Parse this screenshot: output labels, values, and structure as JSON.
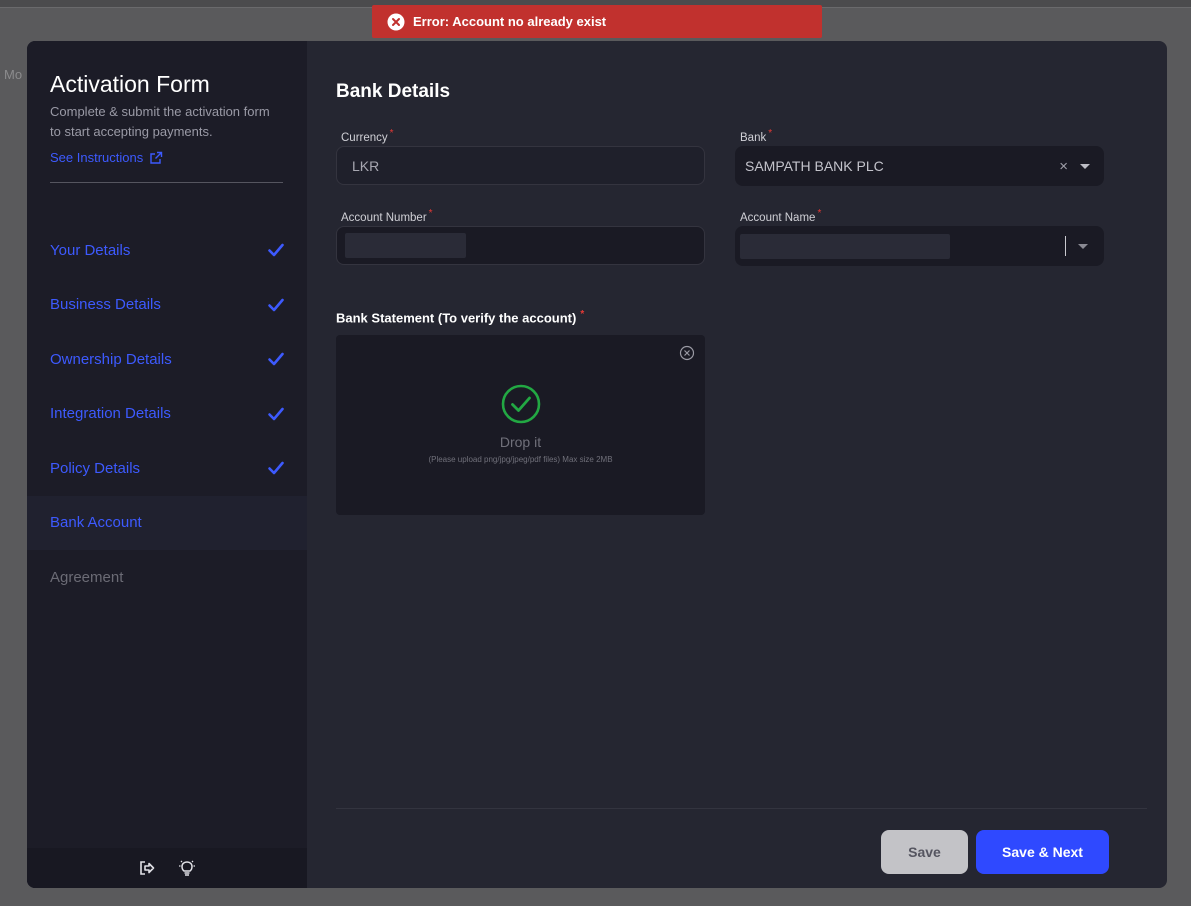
{
  "background": {
    "partial_text": "Mo"
  },
  "toast": {
    "message": "Error: Account no already exist",
    "color": "#c1312e",
    "icon": "error-circle-icon"
  },
  "sidebar": {
    "title": "Activation Form",
    "subtitle": "Complete & submit the activation form to start accepting payments.",
    "instructions_link": "See Instructions",
    "steps": [
      {
        "label": "Your Details",
        "status": "completed"
      },
      {
        "label": "Business Details",
        "status": "completed"
      },
      {
        "label": "Ownership Details",
        "status": "completed"
      },
      {
        "label": "Integration Details",
        "status": "completed"
      },
      {
        "label": "Policy Details",
        "status": "completed"
      },
      {
        "label": "Bank Account",
        "status": "active"
      },
      {
        "label": "Agreement",
        "status": "disabled"
      }
    ],
    "footer_icons": [
      "logout-icon",
      "lightbulb-icon"
    ]
  },
  "main": {
    "title": "Bank Details",
    "currency": {
      "label": "Currency",
      "value": "LKR"
    },
    "bank": {
      "label": "Bank",
      "value": "SAMPATH BANK PLC"
    },
    "account_number": {
      "label": "Account Number",
      "value": ""
    },
    "account_name": {
      "label": "Account Name",
      "value": ""
    },
    "statement": {
      "label": "Bank Statement (To verify the account)",
      "drop_text": "Drop it",
      "hint": "(Please upload png/jpg/jpeg/pdf files) Max size 2MB"
    },
    "buttons": {
      "save": "Save",
      "save_next": "Save & Next"
    }
  },
  "colors": {
    "accent": "#3d5afe",
    "primary_button": "#2f49ff",
    "success": "#22a843",
    "required": "#e53935"
  }
}
